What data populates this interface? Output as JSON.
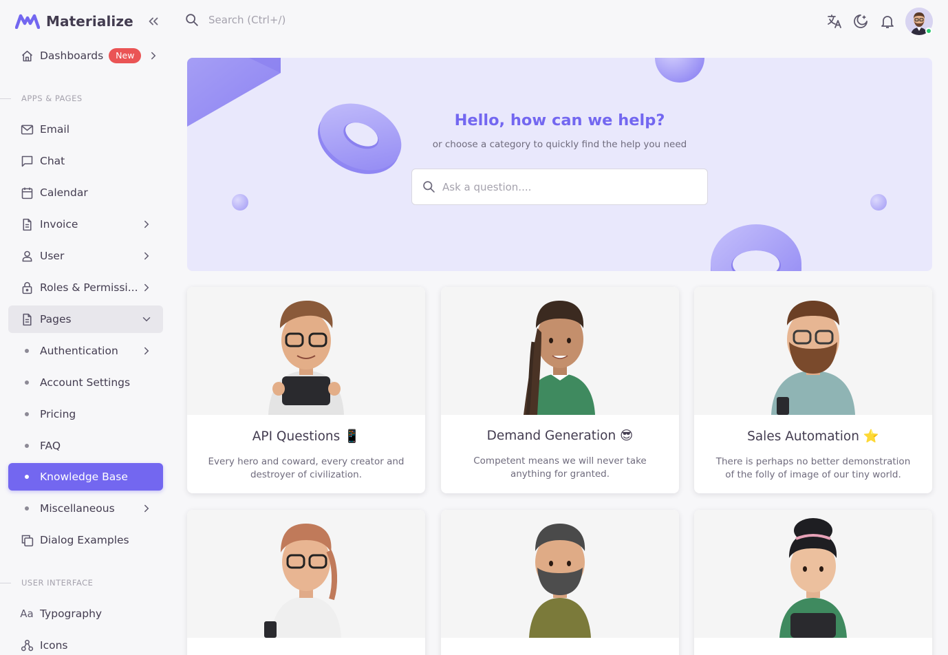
{
  "brand": {
    "name": "Materialize"
  },
  "sidebar": {
    "dashboards": {
      "label": "Dashboards",
      "badge": "New"
    },
    "section_apps": "APPS & PAGES",
    "email": "Email",
    "chat": "Chat",
    "calendar": "Calendar",
    "invoice": "Invoice",
    "user": "User",
    "roles": "Roles & Permissi...",
    "pages": "Pages",
    "authentication": "Authentication",
    "account_settings": "Account Settings",
    "pricing": "Pricing",
    "faq": "FAQ",
    "knowledge_base": "Knowledge Base",
    "miscellaneous": "Miscellaneous",
    "dialog_examples": "Dialog Examples",
    "section_ui": "USER INTERFACE",
    "typography": {
      "icon_text": "Aa",
      "label": "Typography"
    },
    "icons": "Icons"
  },
  "topbar": {
    "search_placeholder": "Search (Ctrl+/)",
    "icons": [
      "translate-icon",
      "moon-icon",
      "bell-icon"
    ]
  },
  "hero": {
    "title": "Hello, how can we help?",
    "subtitle": "or choose a category to quickly find the help you need",
    "search_placeholder": "Ask a question...."
  },
  "cards": [
    {
      "title": "API Questions 📱",
      "description": "Every hero and coward, every creator and destroyer of civilization."
    },
    {
      "title": "Demand Generation 😎",
      "description": "Competent means we will never take anything for granted."
    },
    {
      "title": "Sales Automation ⭐",
      "description": "There is perhaps no better demonstration of the folly of image of our tiny world."
    }
  ],
  "colors": {
    "primary": "#7367f0",
    "badge": "#ea5455",
    "online": "#28c76f"
  }
}
